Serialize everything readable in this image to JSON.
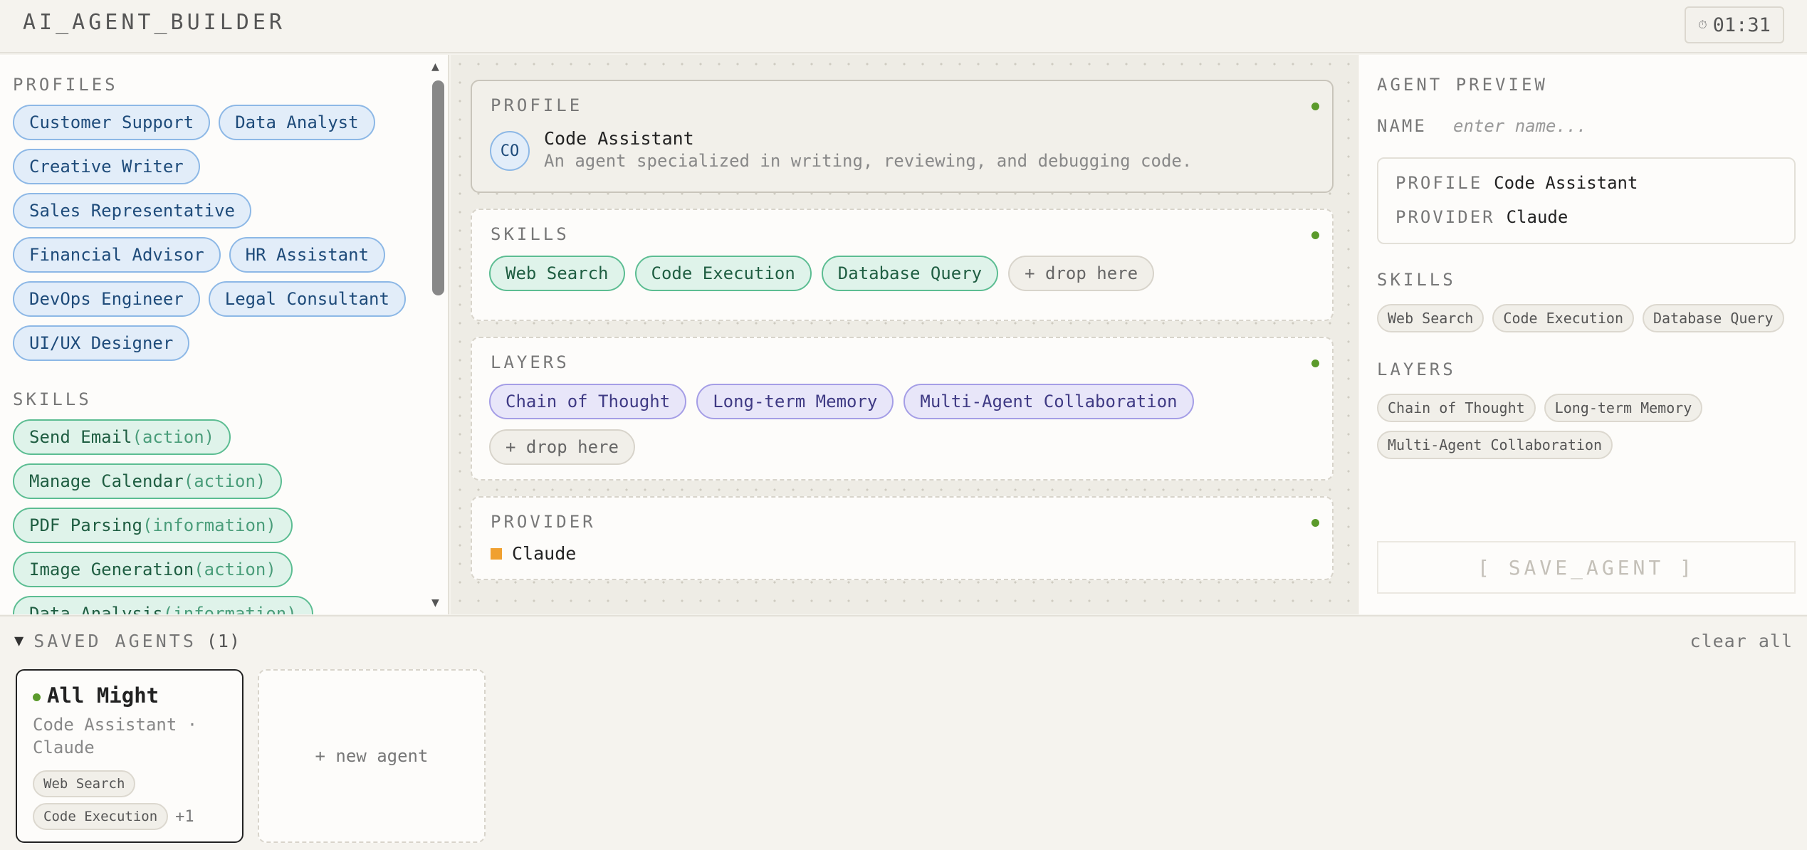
{
  "header": {
    "title": "AI_AGENT_BUILDER",
    "timer": "01:31",
    "timer_icon": "clock-icon"
  },
  "left": {
    "profiles_title": "PROFILES",
    "profiles": [
      "Customer Support",
      "Data Analyst",
      "Creative Writer",
      "Sales Representative",
      "Financial Advisor",
      "HR Assistant",
      "DevOps Engineer",
      "Legal Consultant",
      "UI/UX Designer"
    ],
    "skills_title": "SKILLS",
    "skills": [
      {
        "name": "Send Email",
        "category": "(action)"
      },
      {
        "name": "Manage Calendar",
        "category": "(action)"
      },
      {
        "name": "PDF Parsing",
        "category": "(information)"
      },
      {
        "name": "Image Generation",
        "category": "(action)"
      },
      {
        "name": "Data Analysis",
        "category": "(information)"
      }
    ]
  },
  "canvas": {
    "profile": {
      "title": "PROFILE",
      "avatar": "CO",
      "name": "Code Assistant",
      "description": "An agent specialized in writing, reviewing, and debugging code."
    },
    "skills": {
      "title": "SKILLS",
      "items": [
        "Web Search",
        "Code Execution",
        "Database Query"
      ],
      "drop": "+ drop here"
    },
    "layers": {
      "title": "LAYERS",
      "items": [
        "Chain of Thought",
        "Long-term Memory",
        "Multi-Agent Collaboration"
      ],
      "drop": "+ drop here"
    },
    "provider": {
      "title": "PROVIDER",
      "name": "Claude",
      "color": "#f0a030"
    }
  },
  "preview": {
    "title": "AGENT PREVIEW",
    "name_label": "NAME",
    "name_placeholder": "enter name...",
    "profile_key": "PROFILE",
    "profile_value": "Code Assistant",
    "provider_key": "PROVIDER",
    "provider_value": "Claude",
    "skills_title": "SKILLS",
    "skills": [
      "Web Search",
      "Code Execution",
      "Database Query"
    ],
    "layers_title": "LAYERS",
    "layers": [
      "Chain of Thought",
      "Long-term Memory",
      "Multi-Agent Collaboration"
    ],
    "save_label": "[ SAVE_AGENT ]"
  },
  "saved": {
    "toggle_icon": "▼",
    "title": "SAVED AGENTS",
    "count": "(1)",
    "clear_label": "clear all",
    "agent": {
      "name": "All Might",
      "meta": "Code Assistant · Claude",
      "chips": [
        "Web Search",
        "Code Execution"
      ],
      "more": "+1"
    },
    "new_label": "+ new agent"
  },
  "colors": {
    "accent_green": "#5b9a2b",
    "profile_blue": "#8db8e6",
    "skill_green": "#5cbd92",
    "layer_purple": "#a59ee6"
  }
}
